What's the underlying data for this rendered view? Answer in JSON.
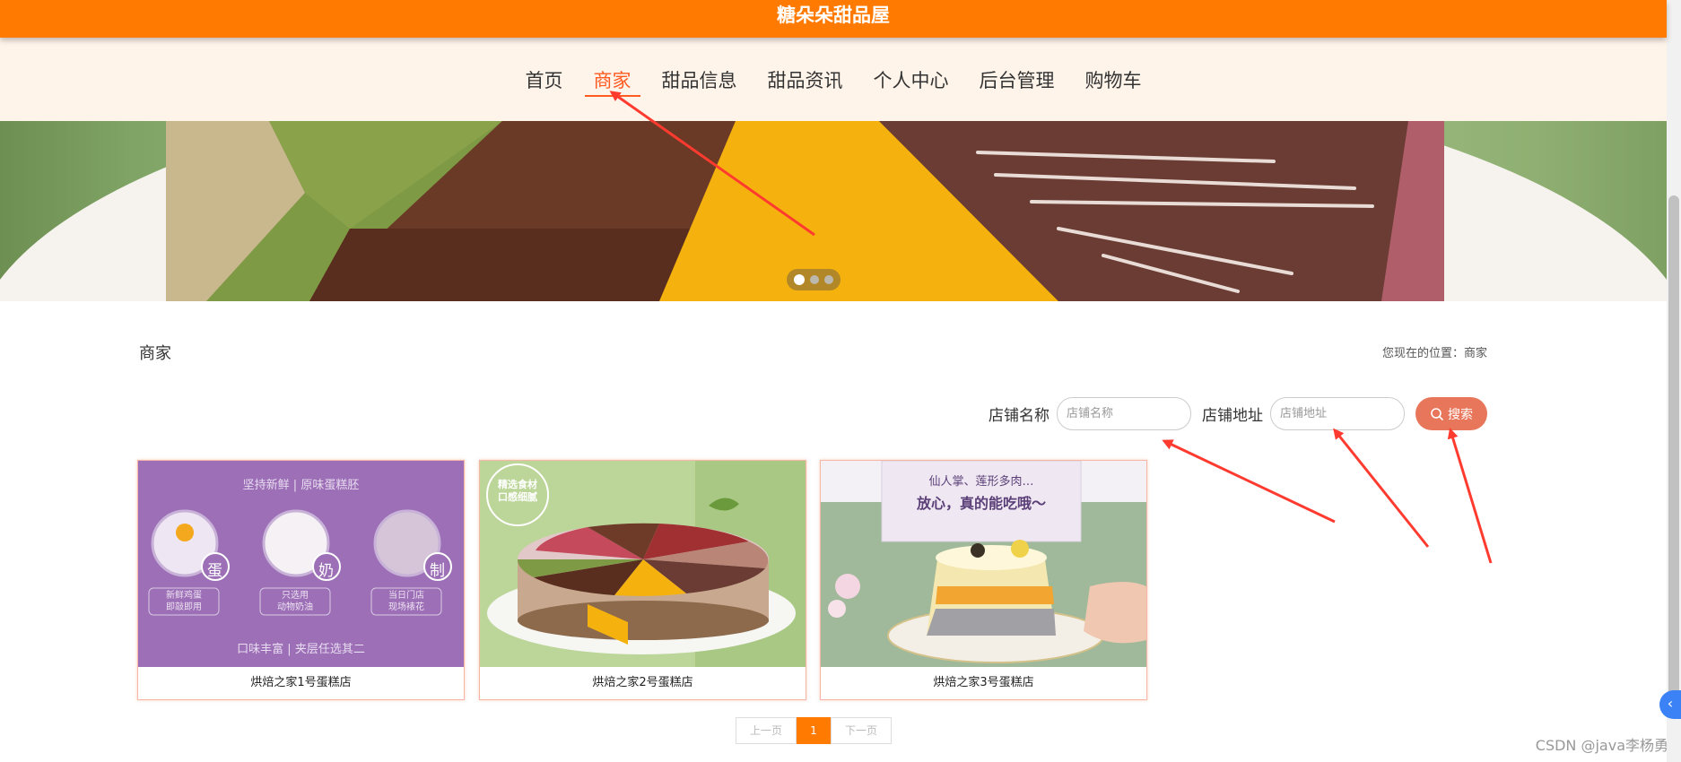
{
  "header": {
    "site_title": "糖朵朵甜品屋"
  },
  "nav": {
    "items": [
      {
        "label": "首页",
        "active": false
      },
      {
        "label": "商家",
        "active": true
      },
      {
        "label": "甜品信息",
        "active": false
      },
      {
        "label": "甜品资讯",
        "active": false
      },
      {
        "label": "个人中心",
        "active": false
      },
      {
        "label": "后台管理",
        "active": false
      },
      {
        "label": "购物车",
        "active": false
      }
    ]
  },
  "banner": {
    "slides": 3,
    "active_slide": 1
  },
  "section": {
    "title": "商家",
    "location": "您现在的位置：商家"
  },
  "search": {
    "shop_name_label": "店铺名称",
    "shop_name_placeholder": "店铺名称",
    "shop_addr_label": "店铺地址",
    "shop_addr_placeholder": "店铺地址",
    "button_label": "搜索"
  },
  "cards": [
    {
      "name": "烘焙之家1号蛋糕店",
      "poster": {
        "top": "坚持新鲜 | 原味蛋糕胚",
        "chars": [
          "蛋",
          "奶",
          "制"
        ],
        "captions": [
          "新鲜鸡蛋\n即敲即用",
          "只选用\n动物奶油",
          "当日门店\n现场裱花"
        ],
        "bottom": "口味丰富 | 夹层任选其二"
      }
    },
    {
      "name": "烘焙之家2号蛋糕店",
      "poster": {
        "seal": "精选食材\n口感细腻"
      }
    },
    {
      "name": "烘焙之家3号蛋糕店",
      "poster": {
        "line1": "仙人掌、莲形多肉…",
        "line2": "放心，真的能吃哦～"
      }
    }
  ],
  "pagination": {
    "prev": "上一页",
    "current": "1",
    "next": "下一页"
  },
  "watermark": "CSDN @java李杨勇",
  "colors": {
    "brand": "#ff7a00",
    "nav_active": "#ff5a1f",
    "search_button": "#e8765a",
    "arrow": "#ff3b30"
  }
}
